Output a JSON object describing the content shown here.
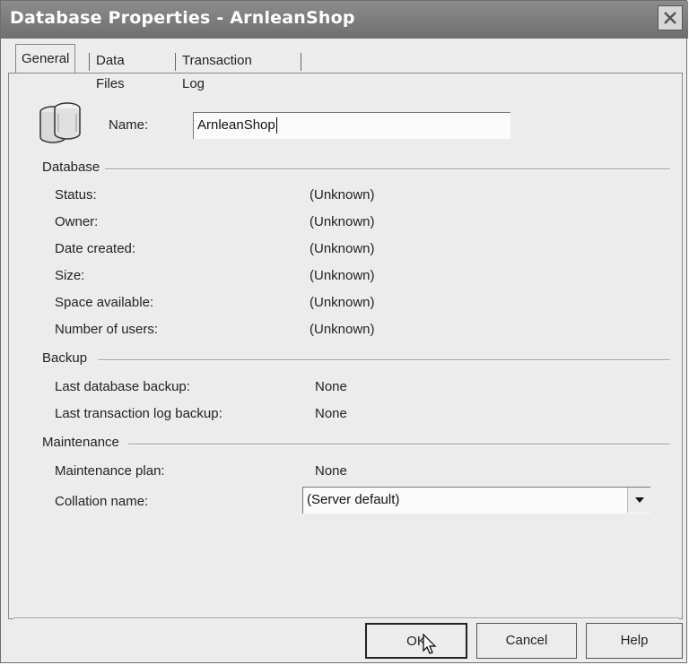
{
  "window": {
    "title": "Database Properties - ArnleanShop"
  },
  "tabs": [
    {
      "label": "General",
      "active": true
    },
    {
      "label": "Data Files",
      "active": false
    },
    {
      "label": "Transaction Log",
      "active": false
    }
  ],
  "name": {
    "label": "Name:",
    "value": "ArnleanShop"
  },
  "sections": {
    "database": {
      "label": "Database",
      "rows": [
        {
          "label": "Status:",
          "value": "(Unknown)"
        },
        {
          "label": "Owner:",
          "value": "(Unknown)"
        },
        {
          "label": "Date created:",
          "value": "(Unknown)"
        },
        {
          "label": "Size:",
          "value": "(Unknown)"
        },
        {
          "label": "Space available:",
          "value": "(Unknown)"
        },
        {
          "label": "Number of users:",
          "value": "(Unknown)"
        }
      ]
    },
    "backup": {
      "label": "Backup",
      "rows": [
        {
          "label": "Last database backup:",
          "value": "None"
        },
        {
          "label": "Last transaction log backup:",
          "value": "None"
        }
      ]
    },
    "maintenance": {
      "label": "Maintenance",
      "rows": [
        {
          "label": "Maintenance plan:",
          "value": "None"
        },
        {
          "label": "Collation name:",
          "value": "(Server default)"
        }
      ]
    }
  },
  "buttons": {
    "ok": "OK",
    "cancel": "Cancel",
    "help": "Help"
  },
  "icons": {
    "database": "database-icon",
    "close": "close-icon",
    "dropdown": "chevron-down-icon",
    "cursor": "mouse-pointer-icon"
  }
}
